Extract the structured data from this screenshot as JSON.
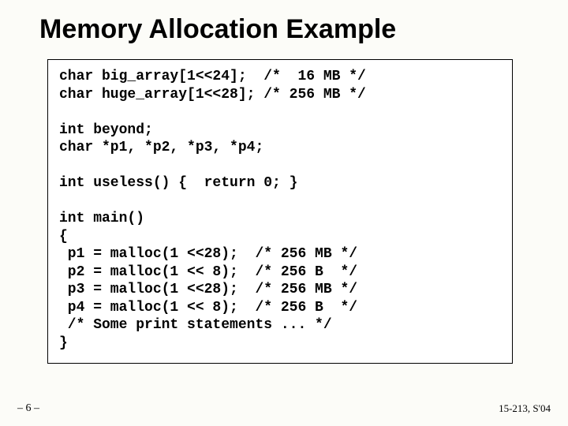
{
  "title": "Memory Allocation Example",
  "code": "char big_array[1<<24];  /*  16 MB */\nchar huge_array[1<<28]; /* 256 MB */\n\nint beyond;\nchar *p1, *p2, *p3, *p4;\n\nint useless() {  return 0; }\n\nint main()\n{\n p1 = malloc(1 <<28);  /* 256 MB */\n p2 = malloc(1 << 8);  /* 256 B  */\n p3 = malloc(1 <<28);  /* 256 MB */\n p4 = malloc(1 << 8);  /* 256 B  */\n /* Some print statements ... */\n}",
  "footer": {
    "left": "– 6 –",
    "right": "15-213, S'04"
  }
}
